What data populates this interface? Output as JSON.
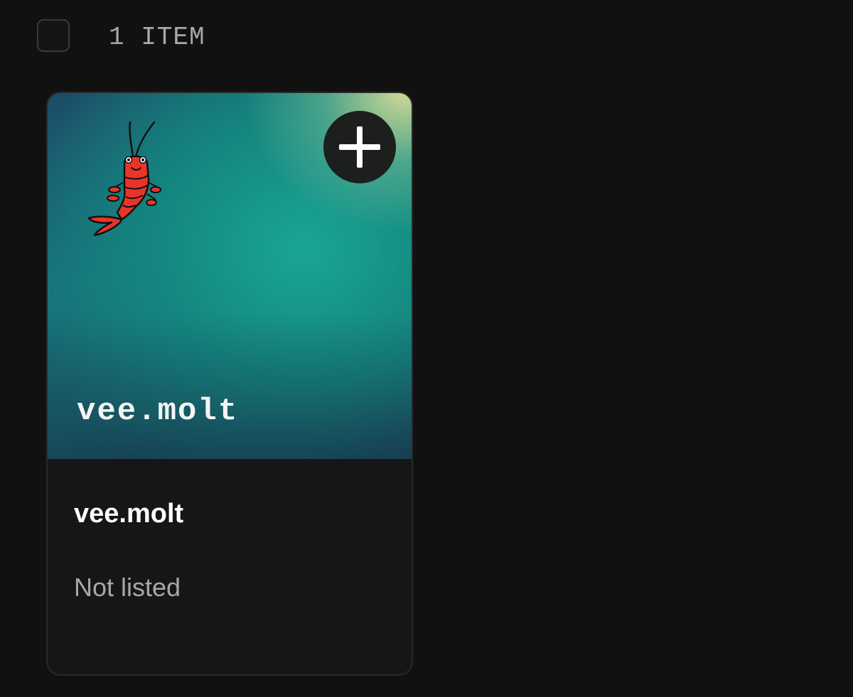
{
  "header": {
    "item_count_label": "1 ITEM"
  },
  "items": [
    {
      "art_title": "vee.molt",
      "name": "vee.molt",
      "status": "Not listed",
      "add_icon": "plus-icon",
      "art_icon": "shrimp-icon"
    }
  ],
  "colors": {
    "background": "#111111",
    "card_background": "#161616",
    "muted_text": "#a8a8a8",
    "shrimp": "#e8352b"
  }
}
